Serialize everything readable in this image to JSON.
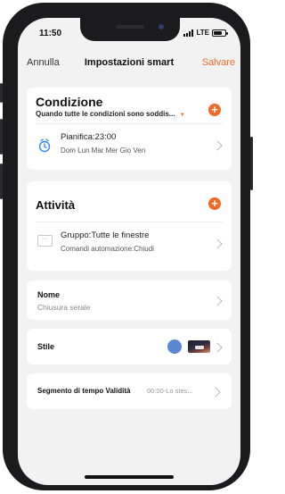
{
  "status": {
    "time": "11:50",
    "network": "LTE"
  },
  "nav": {
    "cancel": "Annulla",
    "title": "Impostazioni smart",
    "save": "Salvare"
  },
  "condition": {
    "title": "Condizione",
    "subtitle": "Quando tutte le condizioni sono soddis...",
    "schedule_title": "Pianifica:23:00",
    "schedule_days": "Dom Lun Mar Mer Gio Ven"
  },
  "activity": {
    "title": "Attività",
    "group_title": "Gruppo:Tutte le finestre",
    "group_sub": "Comandi automazione:Chiudi"
  },
  "name": {
    "label": "Nome",
    "value": "Chiusura serale"
  },
  "style": {
    "label": "Stile",
    "swatch_color": "#5b86d1"
  },
  "validity": {
    "label": "Segmento di tempo Validità",
    "value": "00:00-Lo stes..."
  },
  "colors": {
    "accent": "#f06a2a",
    "icon_blue": "#2d8cf0"
  }
}
